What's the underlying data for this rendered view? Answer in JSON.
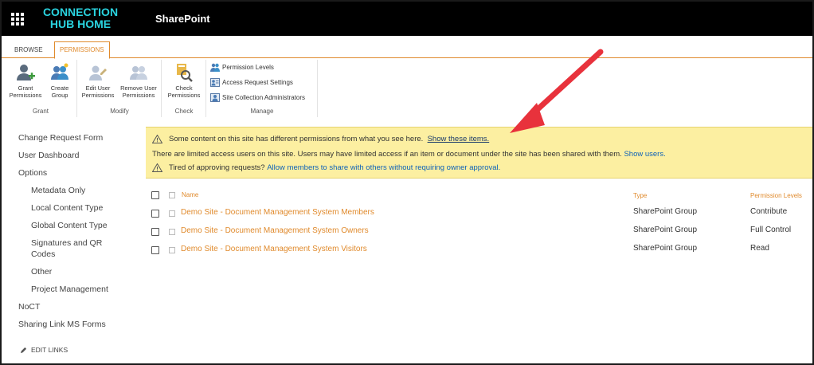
{
  "header": {
    "brand_line1": "CONNECTION",
    "brand_line2": "HUB HOME",
    "suite_title": "SharePoint"
  },
  "ribbon": {
    "tabs": [
      "BROWSE",
      "PERMISSIONS"
    ],
    "active_tab": "PERMISSIONS",
    "groups": {
      "grant": {
        "label": "Grant",
        "buttons": [
          {
            "line1": "Grant",
            "line2": "Permissions",
            "icon": "grant-permissions-icon"
          },
          {
            "line1": "Create",
            "line2": "Group",
            "icon": "create-group-icon"
          }
        ]
      },
      "modify": {
        "label": "Modify",
        "buttons": [
          {
            "line1": "Edit User",
            "line2": "Permissions",
            "icon": "edit-user-icon"
          },
          {
            "line1": "Remove User",
            "line2": "Permissions",
            "icon": "remove-user-icon"
          }
        ]
      },
      "check": {
        "label": "Check",
        "buttons": [
          {
            "line1": "Check",
            "line2": "Permissions",
            "icon": "check-permissions-icon"
          }
        ]
      },
      "manage": {
        "label": "Manage",
        "buttons": [
          {
            "label": "Permission Levels",
            "icon": "permission-levels-icon"
          },
          {
            "label": "Access Request Settings",
            "icon": "access-request-icon"
          },
          {
            "label": "Site Collection Administrators",
            "icon": "site-admins-icon"
          }
        ]
      }
    }
  },
  "left_nav": {
    "items": [
      {
        "label": "Change Request Form",
        "level": 0
      },
      {
        "label": "User Dashboard",
        "level": 0
      },
      {
        "label": "Options",
        "level": 0
      },
      {
        "label": "Metadata Only",
        "level": 1
      },
      {
        "label": "Local Content Type",
        "level": 1
      },
      {
        "label": "Global Content Type",
        "level": 1
      },
      {
        "label": "Signatures and QR Codes",
        "level": 1
      },
      {
        "label": "Other",
        "level": 1
      },
      {
        "label": "Project Management",
        "level": 1
      },
      {
        "label": "NoCT",
        "level": 0
      },
      {
        "label": "Sharing Link MS Forms",
        "level": 0
      }
    ],
    "edit_links": "EDIT LINKS"
  },
  "banner": {
    "line1_text": "Some content on this site has different permissions from what you see here.",
    "line1_link": "Show these items.",
    "line2_text": "There are limited access users on this site. Users may have limited access if an item or document under the site has been shared with them.",
    "line2_link": "Show users.",
    "line3_text": "Tired of approving requests?",
    "line3_link": "Allow members to share with others without requiring owner approval."
  },
  "table": {
    "columns": [
      "Name",
      "Type",
      "Permission Levels"
    ],
    "rows": [
      {
        "name": "Demo Site - Document Management System Members",
        "type": "SharePoint Group",
        "level": "Contribute"
      },
      {
        "name": "Demo Site - Document Management System Owners",
        "type": "SharePoint Group",
        "level": "Full Control"
      },
      {
        "name": "Demo Site - Document Management System Visitors",
        "type": "SharePoint Group",
        "level": "Read"
      }
    ]
  },
  "colors": {
    "accent": "#e08a2c",
    "brand": "#2ad4e0",
    "banner_bg": "#fcefa1",
    "arrow": "#e8323c"
  }
}
